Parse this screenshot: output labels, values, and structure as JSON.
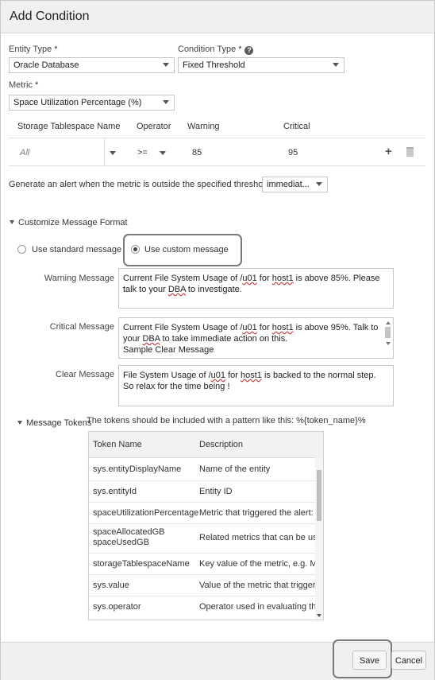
{
  "dialog": {
    "title": "Add Condition"
  },
  "form": {
    "entity_type_label": "Entity Type",
    "entity_type_value": "Oracle Database",
    "condition_type_label": "Condition Type",
    "condition_type_value": "Fixed Threshold",
    "metric_label": "Metric",
    "metric_value": "Space Utilization Percentage (%)",
    "required_mark": "*"
  },
  "threshold": {
    "headers": [
      "Storage Tablespace Name",
      "Operator",
      "Warning",
      "Critical"
    ],
    "row": {
      "name": "All",
      "operator": ">=",
      "warning": "85",
      "critical": "95"
    }
  },
  "alert": {
    "label": "Generate an alert when the metric is outside the specified threshold",
    "value": "immediat..."
  },
  "customize": {
    "title": "Customize Message Format",
    "standard_label": "Use standard message",
    "custom_label": "Use custom message",
    "selected": "custom",
    "warning_label": "Warning Message",
    "warning_text": "Current File System Usage of /u01 for host1 is above 85%.  Please talk to your DBA to investigate.",
    "critical_label": "Critical Message",
    "critical_text": "Current File System Usage of /u01 for host1 is above 95%.  Talk to your DBA to take immediate action on this.\nSample Clear Message",
    "clear_label": "Clear Message",
    "clear_text": "File System Usage of /u01 for host1 is backed to the normal step. So relax for the time being !"
  },
  "tokens": {
    "title": "Message Tokens",
    "hint": "The tokens should be included with a pattern like this: %{token_name}%",
    "col_name": "Token Name",
    "col_desc": "Description",
    "rows": [
      {
        "name": "sys.entityDisplayName",
        "desc": "Name of the entity"
      },
      {
        "name": "sys.entityId",
        "desc": "Entity ID"
      },
      {
        "name": "spaceUtilizationPercentage",
        "desc": "Metric that triggered the alert: S"
      },
      {
        "name": "spaceAllocatedGB\nspaceUsedGB",
        "desc": "Related metrics that can be use"
      },
      {
        "name": "storageTablespaceName",
        "desc": "Key value of the metric, e.g. Mc"
      },
      {
        "name": "sys.value",
        "desc": "Value of the metric that triggere"
      },
      {
        "name": "sys.operator",
        "desc": "Operator used in evaluating the"
      }
    ]
  },
  "footer": {
    "save_label": "Save",
    "cancel_label": "Cancel"
  }
}
